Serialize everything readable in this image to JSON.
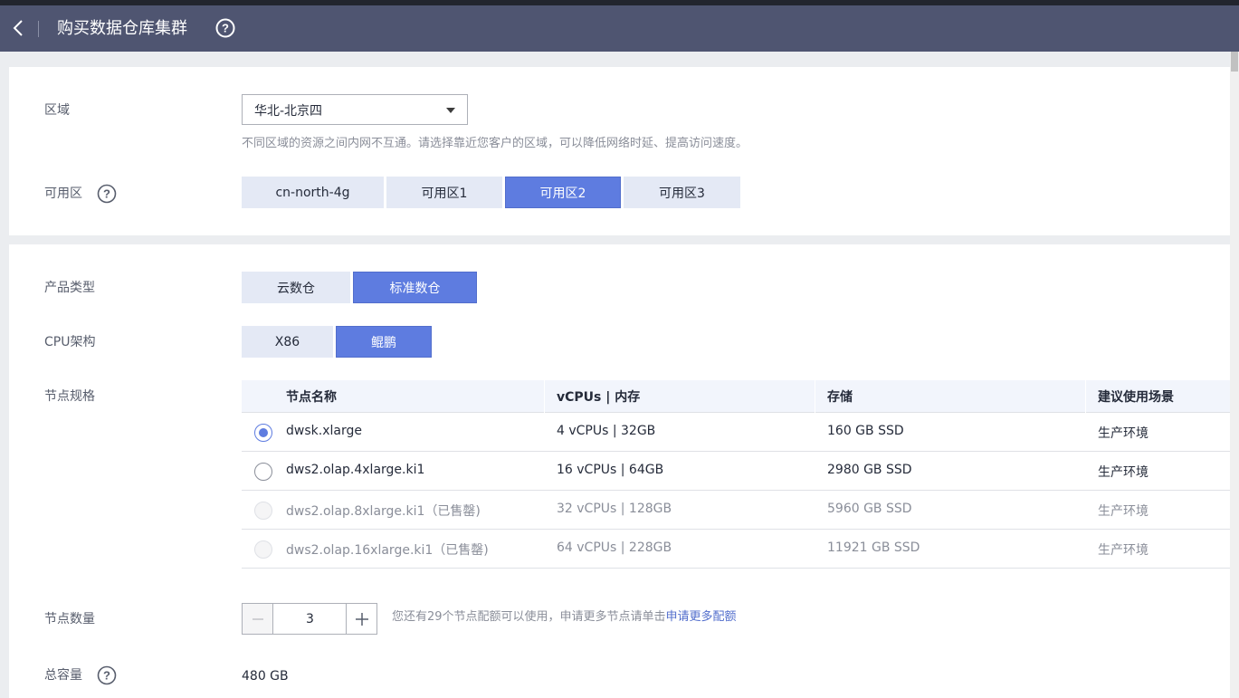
{
  "header": {
    "title": "购买数据仓库集群"
  },
  "region": {
    "label": "区域",
    "value": "华北-北京四",
    "hint": "不同区域的资源之间内网不互通。请选择靠近您客户的区域，可以降低网络时延、提高访问速度。"
  },
  "az": {
    "label": "可用区",
    "options": [
      "cn-north-4g",
      "可用区1",
      "可用区2",
      "可用区3"
    ],
    "selected": "可用区2"
  },
  "product_type": {
    "label": "产品类型",
    "options": [
      "云数仓",
      "标准数仓"
    ],
    "selected": "标准数仓"
  },
  "cpu_arch": {
    "label": "CPU架构",
    "options": [
      "X86",
      "鲲鹏"
    ],
    "selected": "鲲鹏"
  },
  "node_spec": {
    "label": "节点规格",
    "columns": [
      "节点名称",
      "vCPUs | 内存",
      "存储",
      "建议使用场景"
    ],
    "rows": [
      {
        "name": "dwsk.xlarge",
        "cpu_mem": "4 vCPUs | 32GB",
        "storage": "160 GB SSD",
        "scene": "生产环境",
        "state": "selected"
      },
      {
        "name": "dws2.olap.4xlarge.ki1",
        "cpu_mem": "16 vCPUs | 64GB",
        "storage": "2980 GB SSD",
        "scene": "生产环境",
        "state": "enabled"
      },
      {
        "name": "dws2.olap.8xlarge.ki1（已售罄)",
        "cpu_mem": "32 vCPUs | 128GB",
        "storage": "5960 GB SSD",
        "scene": "生产环境",
        "state": "disabled"
      },
      {
        "name": "dws2.olap.16xlarge.ki1（已售罄)",
        "cpu_mem": "64 vCPUs | 228GB",
        "storage": "11921 GB SSD",
        "scene": "生产环境",
        "state": "disabled"
      }
    ]
  },
  "node_count": {
    "label": "节点数量",
    "value": "3",
    "hint_prefix": "您还有29个节点配额可以使用，申请更多节点请单击",
    "hint_link": "申请更多配额"
  },
  "total_capacity": {
    "label": "总容量",
    "value": "480 GB"
  },
  "colors": {
    "header_bg": "#4f5571",
    "accent": "#5e7ce0",
    "segment_bg": "#e4e9f5",
    "link": "#526ecc"
  },
  "icons": {
    "back": "chevron-left-icon",
    "help": "question-circle-icon",
    "dropdown": "caret-down-icon",
    "minus": "minus-icon",
    "plus": "plus-icon"
  }
}
